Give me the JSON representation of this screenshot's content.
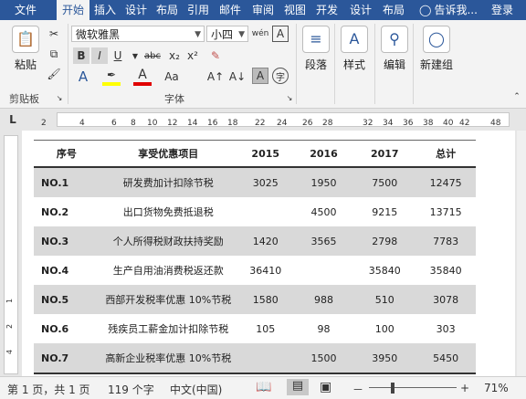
{
  "tabs": [
    {
      "label": "文件",
      "active": false
    },
    {
      "label": "开始",
      "active": true
    },
    {
      "label": "插入",
      "active": false
    },
    {
      "label": "设计",
      "active": false
    },
    {
      "label": "布局",
      "active": false
    },
    {
      "label": "引用",
      "active": false
    },
    {
      "label": "邮件",
      "active": false
    },
    {
      "label": "审阅",
      "active": false
    },
    {
      "label": "视图",
      "active": false
    },
    {
      "label": "开发",
      "active": false
    },
    {
      "label": "设计",
      "active": false
    },
    {
      "label": "布局",
      "active": false
    },
    {
      "label": "告诉我...",
      "active": false
    },
    {
      "label": "登录",
      "active": false
    }
  ],
  "ribbon": {
    "clipboard": {
      "paste": "粘贴",
      "group": "剪贴板"
    },
    "font": {
      "name": "微软雅黑",
      "size": "小四",
      "group": "字体",
      "bold": "B",
      "italic": "I",
      "underline": "U",
      "strike": "abc",
      "sub": "x₂",
      "sup": "x²",
      "grow": "A↑",
      "shrink": "A↓",
      "wen": "wén",
      "clear": "A"
    },
    "paragraph": {
      "label": "段落"
    },
    "styles": {
      "label": "样式"
    },
    "editing": {
      "label": "编辑"
    },
    "newgroup": {
      "label": "新建组"
    }
  },
  "ruler": {
    "ticks": [
      "2",
      "2",
      "4",
      "6",
      "8",
      "10",
      "12",
      "14",
      "16",
      "18",
      "20",
      "22",
      "24",
      "26",
      "28",
      "30",
      "32",
      "34",
      "36",
      "38",
      "40",
      "42",
      "44",
      "46",
      "48"
    ],
    "tab_stop": "L",
    "vticks": [
      "1",
      "2",
      "4"
    ]
  },
  "table": {
    "headers": [
      "序号",
      "享受优惠项目",
      "2015",
      "2016",
      "2017",
      "总计"
    ],
    "rows": [
      {
        "no": "NO.1",
        "item": "研发费加计扣除节税",
        "y2015": "3025",
        "y2016": "1950",
        "y2017": "7500",
        "total": "12475",
        "shade": true
      },
      {
        "no": "NO.2",
        "item": "出口货物免费抵退税",
        "y2015": "",
        "y2016": "4500",
        "y2017": "9215",
        "total": "13715",
        "shade": false
      },
      {
        "no": "NO.3",
        "item": "个人所得税财政扶持奖励",
        "y2015": "1420",
        "y2016": "3565",
        "y2017": "2798",
        "total": "7783",
        "shade": true
      },
      {
        "no": "NO.4",
        "item": "生产自用油消费税返还款",
        "y2015": "36410",
        "y2016": "",
        "y2017": "35840",
        "total": "35840",
        "shade": false
      },
      {
        "no": "NO.5",
        "item": "西部开发税率优惠 10%节税",
        "y2015": "1580",
        "y2016": "988",
        "y2017": "510",
        "total": "3078",
        "shade": true
      },
      {
        "no": "NO.6",
        "item": "残疾员工薪金加计扣除节税",
        "y2015": "105",
        "y2016": "98",
        "y2017": "100",
        "total": "303",
        "shade": false
      },
      {
        "no": "NO.7",
        "item": "高新企业税率优惠 10%节税",
        "y2015": "",
        "y2016": "1500",
        "y2017": "3950",
        "total": "5450",
        "shade": true
      }
    ]
  },
  "status": {
    "page": "第 1 页，共 1 页",
    "words": "119 个字",
    "lang": "中文(中国)",
    "zoom": "71%",
    "minus": "－",
    "plus": "+"
  },
  "colors": {
    "accent": "#2b579a",
    "shade": "#d9d9d9"
  }
}
